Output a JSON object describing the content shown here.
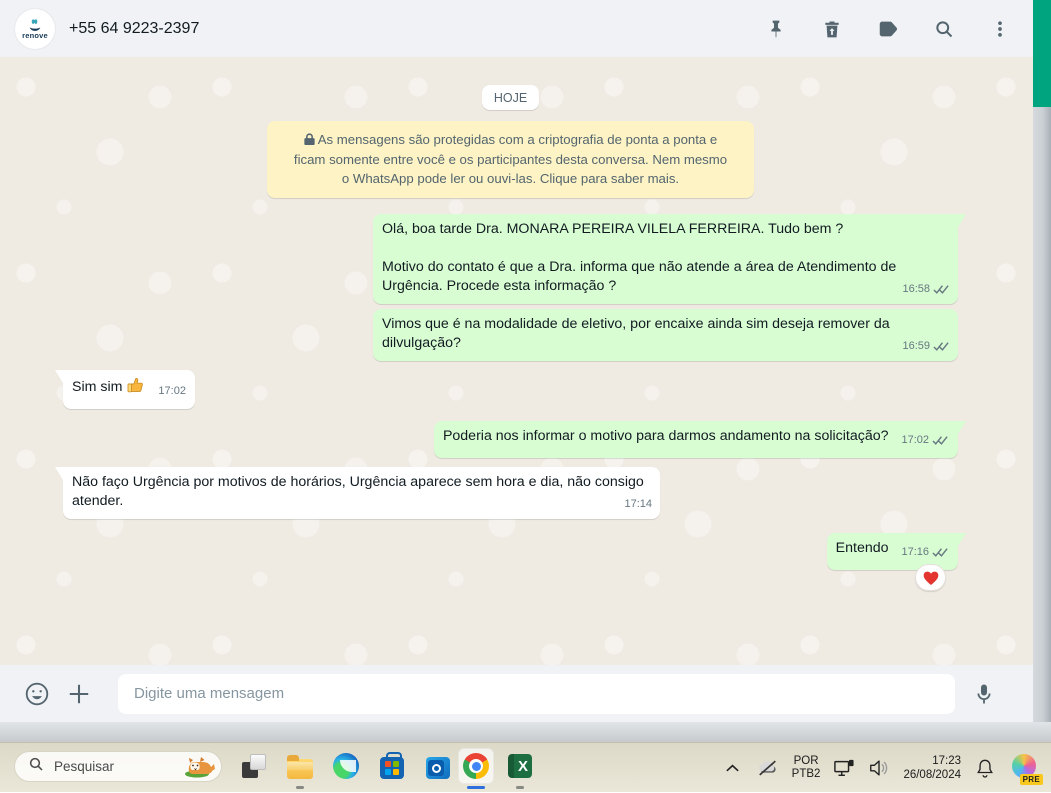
{
  "header": {
    "contact_phone": "+55 64 9223-2397",
    "avatar_word": "renove",
    "icons": [
      "pin-icon",
      "delete-icon",
      "label-icon",
      "search-icon",
      "menu-icon"
    ]
  },
  "chat": {
    "date_divider": "HOJE",
    "encryption_notice": "As mensagens são protegidas com a criptografia de ponta a ponta e ficam somente entre você e os participantes desta conversa. Nem mesmo o WhatsApp pode ler ou ouvi-las. Clique para saber mais.",
    "messages": [
      {
        "direction": "out",
        "text": "Olá, boa tarde Dra. MONARA PEREIRA VILELA FERREIRA. Tudo bem ?\n\nMotivo do contato é que a Dra. informa que não atende a área de Atendimento de Urgência. Procede esta informação ?",
        "time": "16:58",
        "status": "delivered-double-check"
      },
      {
        "direction": "out",
        "text": "Vimos que é na modalidade de eletivo, por encaixe ainda sim deseja remover da dilvulgação?",
        "time": "16:59",
        "status": "delivered-double-check"
      },
      {
        "direction": "in",
        "text": "Sim sim",
        "emoji": "thumbs-up",
        "time": "17:02"
      },
      {
        "direction": "out",
        "text": "Poderia nos informar o motivo para darmos andamento na solicitação?",
        "time": "17:02",
        "status": "delivered-double-check"
      },
      {
        "direction": "in",
        "text": "Não faço Urgência por motivos de horários, Urgência aparece sem hora e dia, não consigo atender.",
        "time": "17:14"
      },
      {
        "direction": "out",
        "text": "Entendo",
        "time": "17:16",
        "status": "delivered-double-check",
        "reaction": "heart"
      }
    ]
  },
  "composer": {
    "placeholder": "Digite uma mensagem",
    "icons": [
      "emoji-icon",
      "attach-plus-icon",
      "mic-icon"
    ]
  },
  "taskbar": {
    "search_label": "Pesquisar",
    "pinned_apps": [
      "task-view",
      "file-explorer",
      "edge",
      "microsoft-store",
      "outlook",
      "chrome",
      "excel"
    ],
    "active_app": "chrome",
    "tray": {
      "language_line1": "POR",
      "language_line2": "PTB2",
      "time": "17:23",
      "date": "26/08/2024",
      "copilot_badge": "PRE"
    }
  },
  "colors": {
    "accent_teal": "#00a47e",
    "header_bg": "#f0f2f5",
    "wallpaper": "#efeae2",
    "bubble_out": "#d9fdd3",
    "bubble_in": "#ffffff",
    "notice_bg": "#fdf3c5",
    "meta_text": "#667781"
  }
}
